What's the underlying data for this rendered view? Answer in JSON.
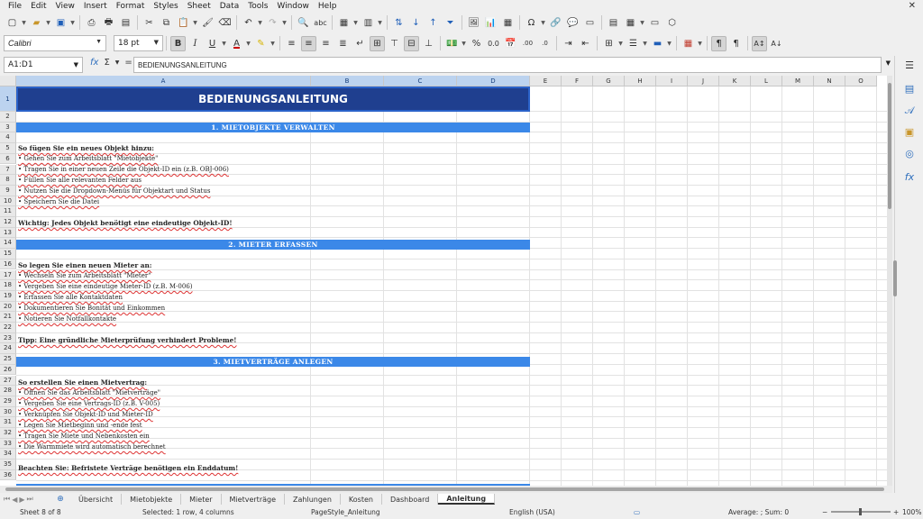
{
  "menu": [
    "File",
    "Edit",
    "View",
    "Insert",
    "Format",
    "Styles",
    "Sheet",
    "Data",
    "Tools",
    "Window",
    "Help"
  ],
  "font": {
    "name": "Calibri",
    "size": "18 pt"
  },
  "formula_bar": {
    "cell_ref": "A1:D1",
    "content": "BEDIENUNGSANLEITUNG"
  },
  "columns": [
    "A",
    "B",
    "C",
    "D",
    "E",
    "F",
    "G",
    "H",
    "I",
    "J",
    "K",
    "L",
    "M",
    "N",
    "O"
  ],
  "rows": [
    "1",
    "2",
    "3",
    "4",
    "5",
    "6",
    "7",
    "8",
    "9",
    "10",
    "11",
    "12",
    "13",
    "14",
    "15",
    "16",
    "17",
    "18",
    "19",
    "20",
    "21",
    "22",
    "23",
    "24",
    "25",
    "26",
    "27",
    "28",
    "29",
    "30",
    "31",
    "32",
    "33",
    "34",
    "35",
    "36"
  ],
  "sheet": {
    "title": "BEDIENUNGSANLEITUNG",
    "sections": [
      {
        "header": "1. MIETOBJEKTE VERWALTEN",
        "intro": "So fügen Sie ein neues Objekt hinzu:",
        "steps": [
          "• Gehen Sie zum Arbeitsblatt \"Mietobjekte\"",
          "• Tragen Sie in einer neuen Zeile die Objekt-ID ein (z.B. OBJ-006)",
          "• Füllen Sie alle relevanten Felder aus",
          "• Nutzen Sie die Dropdown-Menüs für Objektart und Status",
          "• Speichern Sie die Datei"
        ],
        "note": "Wichtig: Jedes Objekt benötigt eine eindeutige Objekt-ID!"
      },
      {
        "header": "2. MIETER ERFASSEN",
        "intro": "So legen Sie einen neuen Mieter an:",
        "steps": [
          "• Wechseln Sie zum Arbeitsblatt \"Mieter\"",
          "• Vergeben Sie eine eindeutige Mieter-ID (z.B. M-006)",
          "• Erfassen Sie alle Kontaktdaten",
          "• Dokumentieren Sie Bonität und Einkommen",
          "• Notieren Sie Notfallkontakte"
        ],
        "note": "Tipp: Eine gründliche Mieterprüfung verhindert Probleme!"
      },
      {
        "header": "3. MIETVERTRÄGE ANLEGEN",
        "intro": "So erstellen Sie einen Mietvertrag:",
        "steps": [
          "• Öffnen Sie das Arbeitsblatt \"Mietverträge\"",
          "• Vergeben Sie eine Vertrags-ID (z.B. V-005)",
          "• Verknüpfen Sie Objekt-ID und Mieter-ID",
          "• Legen Sie Mietbeginn und -ende fest",
          "• Tragen Sie Miete und Nebenkosten ein",
          "• Die Warmmiete wird automatisch berechnet"
        ],
        "note": "Beachten Sie: Befristete Verträge benötigen ein Enddatum!"
      }
    ]
  },
  "tabs": [
    "Übersicht",
    "Mietobjekte",
    "Mieter",
    "Mietverträge",
    "Zahlungen",
    "Kosten",
    "Dashboard",
    "Anleitung"
  ],
  "active_tab": "Anleitung",
  "status": {
    "sheet": "Sheet 8 of 8",
    "selection": "Selected: 1 row, 4 columns",
    "page_style": "PageStyle_Anleitung",
    "language": "English (USA)",
    "summary": "Average: ; Sum: 0",
    "zoom": "100%"
  },
  "colors": {
    "title_bg": "#1f3f8f",
    "section_bg": "#3b88e8",
    "selection": "#bcd3ef"
  }
}
